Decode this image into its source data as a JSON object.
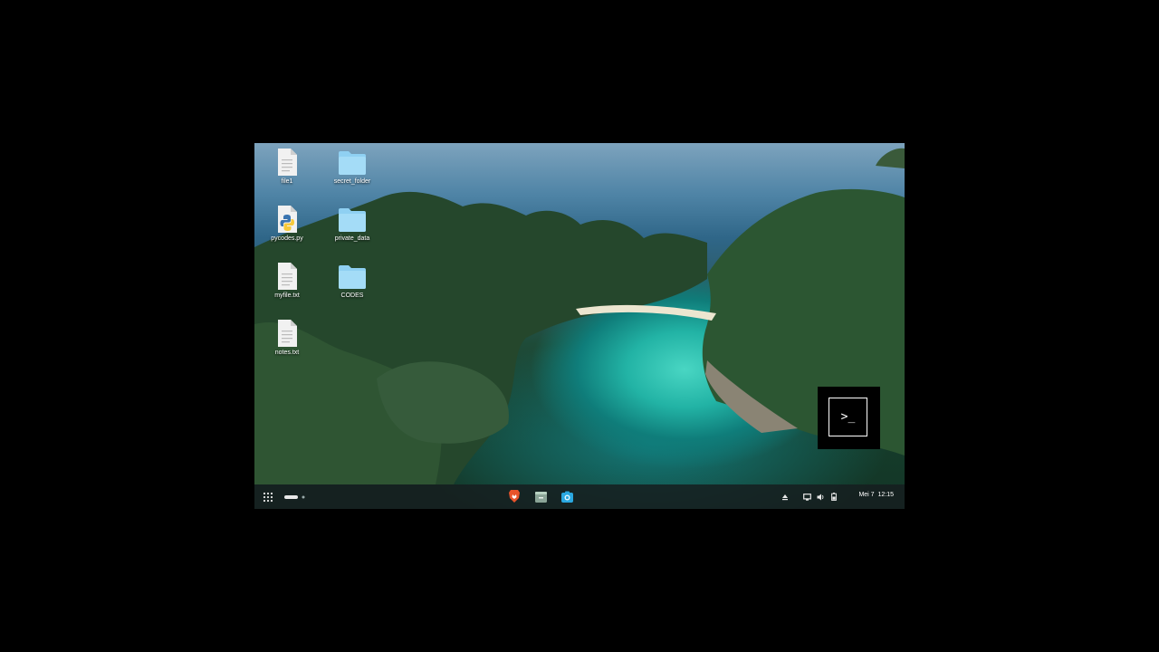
{
  "desktop": {
    "icons": [
      {
        "label": "file1",
        "type": "file"
      },
      {
        "label": "secret_folder",
        "type": "folder"
      },
      {
        "label": "pycodes.py",
        "type": "python"
      },
      {
        "label": "private_data",
        "type": "folder"
      },
      {
        "label": "myfile.txt",
        "type": "file"
      },
      {
        "label": "CODES",
        "type": "folder"
      },
      {
        "label": "notes.txt",
        "type": "file"
      }
    ]
  },
  "terminal_popup": {
    "prompt": ">_",
    "icon": "terminal-icon"
  },
  "taskbar": {
    "launcher_icon": "app-grid-icon",
    "apps": [
      "brave-browser-icon",
      "file-manager-icon",
      "camera-icon"
    ],
    "tray": [
      "eject-icon",
      "screen-icon",
      "volume-icon",
      "battery-icon"
    ],
    "date": "Mei 7",
    "time": "12:15"
  },
  "colors": {
    "folder": "#8fd0f2",
    "taskbar": "#161e20",
    "brave": "#e8532a",
    "camera": "#2aa8e0"
  }
}
